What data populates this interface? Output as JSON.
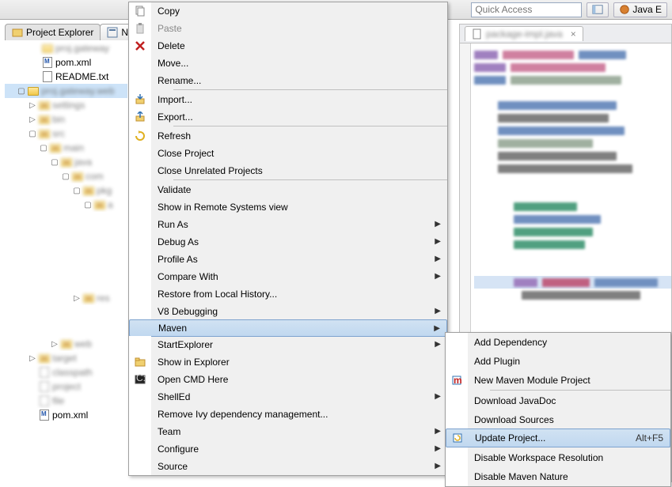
{
  "toolbar": {
    "quick_access_placeholder": "Quick Access",
    "perspective": "Java E"
  },
  "views": {
    "project_explorer": "Project Explorer",
    "navigator": "Na"
  },
  "tree": {
    "pom": "pom.xml",
    "readme": "README.txt",
    "pom2": "pom.xml"
  },
  "contextMenu": {
    "copy": "Copy",
    "paste": "Paste",
    "delete": "Delete",
    "move": "Move...",
    "rename": "Rename...",
    "import": "Import...",
    "export": "Export...",
    "refresh": "Refresh",
    "close_project": "Close Project",
    "close_unrelated": "Close Unrelated Projects",
    "validate": "Validate",
    "remote_systems": "Show in Remote Systems view",
    "run_as": "Run As",
    "debug_as": "Debug As",
    "profile_as": "Profile As",
    "compare_with": "Compare With",
    "restore_history": "Restore from Local History...",
    "v8_debugging": "V8 Debugging",
    "maven": "Maven",
    "start_explorer": "StartExplorer",
    "show_in_explorer": "Show in Explorer",
    "open_cmd": "Open CMD Here",
    "shelled": "ShellEd",
    "remove_ivy": "Remove Ivy dependency management...",
    "team": "Team",
    "configure": "Configure",
    "source": "Source"
  },
  "submenu": {
    "add_dependency": "Add Dependency",
    "add_plugin": "Add Plugin",
    "new_maven_module": "New Maven Module Project",
    "download_javadoc": "Download JavaDoc",
    "download_sources": "Download Sources",
    "update_project": "Update Project...",
    "update_project_shortcut": "Alt+F5",
    "disable_workspace": "Disable Workspace Resolution",
    "disable_maven": "Disable Maven Nature"
  }
}
